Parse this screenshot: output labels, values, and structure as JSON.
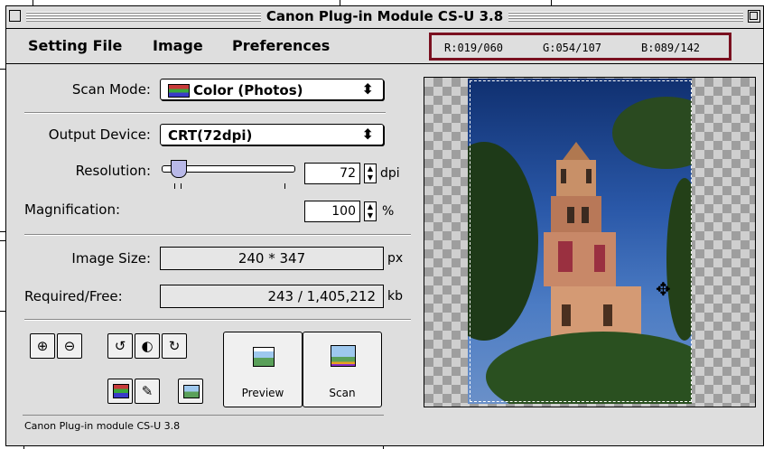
{
  "window": {
    "title": "Canon Plug-in Module CS-U 3.8",
    "status": "Canon Plug-in module CS-U 3.8"
  },
  "menu": {
    "setting_file": "Setting File",
    "image": "Image",
    "preferences": "Preferences"
  },
  "rgb_readout": {
    "r": "R:019/060",
    "g": "G:054/107",
    "b": "B:089/142",
    "highlight_color": "#7a1020"
  },
  "scan_mode": {
    "label": "Scan Mode:",
    "value": "Color (Photos)"
  },
  "output_device": {
    "label": "Output Device:",
    "value": "CRT(72dpi)"
  },
  "resolution": {
    "label": "Resolution:",
    "value": "72",
    "unit": "dpi"
  },
  "magnification": {
    "label": "Magnification:",
    "value": "100",
    "unit": "%"
  },
  "image_size": {
    "label": "Image Size:",
    "value": "240 * 347",
    "unit": "px"
  },
  "required_free": {
    "label": "Required/Free:",
    "value": "243 / 1,405,212",
    "unit": "kb"
  },
  "buttons": {
    "preview": "Preview",
    "scan": "Scan"
  },
  "icons": [
    "zoom-in-icon",
    "zoom-out-icon",
    "rotate-left-icon",
    "mirror-icon",
    "rotate-right-icon",
    "color-adjust-icon",
    "eyedropper-icon",
    "image-icon",
    "preview-icon",
    "scan-icon",
    "move-cursor-icon"
  ]
}
